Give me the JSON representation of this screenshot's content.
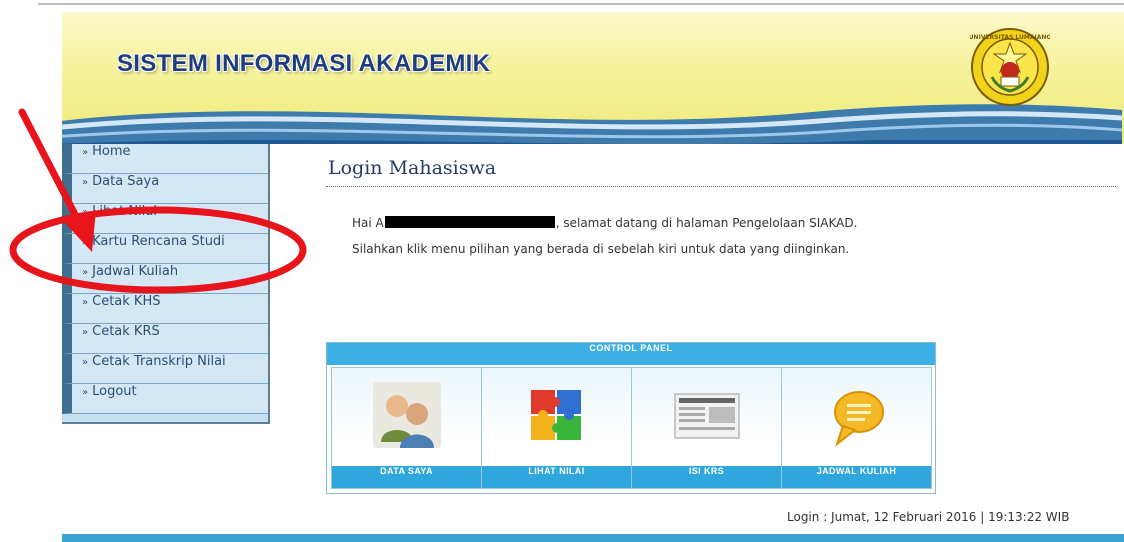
{
  "header": {
    "title": "SISTEM INFORMASI AKADEMIK",
    "logo_ring_text": "UNIVERSITAS LUMAJANG"
  },
  "sidebar": {
    "items": [
      {
        "label": "Home"
      },
      {
        "label": "Data Saya"
      },
      {
        "label": "Lihat Nilai"
      },
      {
        "label": "Kartu Rencana Studi"
      },
      {
        "label": "Jadwal Kuliah"
      },
      {
        "label": "Cetak KHS"
      },
      {
        "label": "Cetak KRS"
      },
      {
        "label": "Cetak Transkrip Nilai"
      },
      {
        "label": "Logout"
      }
    ]
  },
  "main": {
    "title": "Login Mahasiswa",
    "greeting_prefix": "Hai A",
    "greeting_suffix": ", selamat datang di halaman Pengelolaan SIAKAD.",
    "instruction": "Silahkan klik menu pilihan yang berada di sebelah kiri untuk data yang diinginkan."
  },
  "control_panel": {
    "title": "CONTROL PANEL",
    "items": [
      {
        "label": "DATA SAYA",
        "icon": "users-icon"
      },
      {
        "label": "LIHAT NILAI",
        "icon": "puzzle-icon"
      },
      {
        "label": "ISI KRS",
        "icon": "newspaper-icon"
      },
      {
        "label": "JADWAL KULIAH",
        "icon": "speech-bubble-icon"
      }
    ]
  },
  "footer": {
    "login_info": "Login : Jumat, 12 Februari 2016 | 19:13:22 WIB"
  },
  "colors": {
    "accent": "#3cb0e4",
    "menu_text": "#2b4f72",
    "annotation": "#e8141b"
  }
}
